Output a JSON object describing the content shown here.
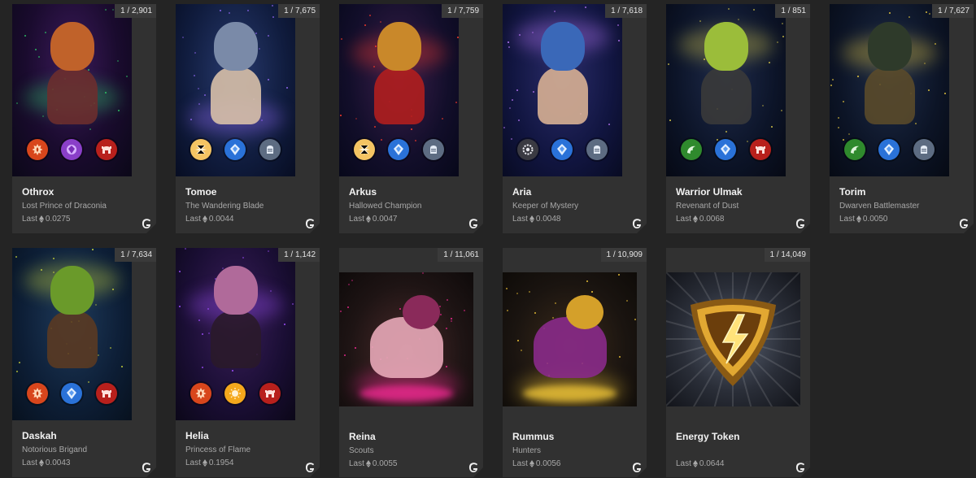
{
  "cards": [
    {
      "edition": "1 / 2,901",
      "name": "Othrox",
      "subtitle": "Lost Prince of Draconia",
      "last_label": "Last",
      "price": "0.0275",
      "affinities": [
        "fire-icon",
        "gem-icon",
        "helmet-red-icon"
      ],
      "art": "othrox"
    },
    {
      "edition": "1 / 7,675",
      "name": "Tomoe",
      "subtitle": "The Wandering Blade",
      "last_label": "Last",
      "price": "0.0044",
      "affinities": [
        "star-burst-icon",
        "diamond-icon",
        "knight-helmet-icon"
      ],
      "art": "tomoe"
    },
    {
      "edition": "1 / 7,759",
      "name": "Arkus",
      "subtitle": "Hallowed Champion",
      "last_label": "Last",
      "price": "0.0047",
      "affinities": [
        "star-burst-icon",
        "diamond-icon",
        "knight-helmet-icon"
      ],
      "art": "arkus"
    },
    {
      "edition": "1 / 7,618",
      "name": "Aria",
      "subtitle": "Keeper of Mystery",
      "last_label": "Last",
      "price": "0.0048",
      "affinities": [
        "eye-gear-icon",
        "diamond-icon",
        "knight-helmet-icon"
      ],
      "art": "aria"
    },
    {
      "edition": "1 / 851",
      "name": "Warrior Ulmak",
      "subtitle": "Revenant of Dust",
      "last_label": "Last",
      "price": "0.0068",
      "affinities": [
        "claw-icon",
        "diamond-icon",
        "helmet-red-icon"
      ],
      "art": "ulmak"
    },
    {
      "edition": "1 / 7,627",
      "name": "Torim",
      "subtitle": "Dwarven Battlemaster",
      "last_label": "Last",
      "price": "0.0050",
      "affinities": [
        "claw-icon",
        "diamond-icon",
        "knight-helmet-icon"
      ],
      "art": "torim"
    },
    {
      "edition": "1 / 7,634",
      "name": "Daskah",
      "subtitle": "Notorious Brigand",
      "last_label": "Last",
      "price": "0.0043",
      "affinities": [
        "fire-icon",
        "diamond-icon",
        "helmet-red-icon"
      ],
      "art": "daskah"
    },
    {
      "edition": "1 / 1,142",
      "name": "Helia",
      "subtitle": "Princess of Flame",
      "last_label": "Last",
      "price": "0.1954",
      "affinities": [
        "fire-icon",
        "sun-icon",
        "helmet-red-icon"
      ],
      "art": "helia"
    },
    {
      "edition": "1 / 11,061",
      "name": "Reina",
      "subtitle": "Scouts",
      "last_label": "Last",
      "price": "0.0055",
      "art": "reina"
    },
    {
      "edition": "1 / 10,909",
      "name": "Rummus",
      "subtitle": "Hunters",
      "last_label": "Last",
      "price": "0.0056",
      "art": "rummus"
    },
    {
      "edition": "1 / 14,049",
      "name": "Energy Token",
      "subtitle": "",
      "last_label": "Last",
      "price": "0.0644",
      "art": "token"
    }
  ],
  "colors": {
    "page_bg": "#242424",
    "card_bg": "#313131",
    "fire": "#d8461c",
    "gem_purple": "#8a3fc8",
    "helmet_red": "#b8201c",
    "diamond_blue": "#2a72d8",
    "knight_grey": "#5d6c82",
    "star_gold": "#f4c463",
    "claw_green": "#2f8a2d",
    "sun_orange": "#f5a81c",
    "eye_dark": "#3a3a42"
  }
}
